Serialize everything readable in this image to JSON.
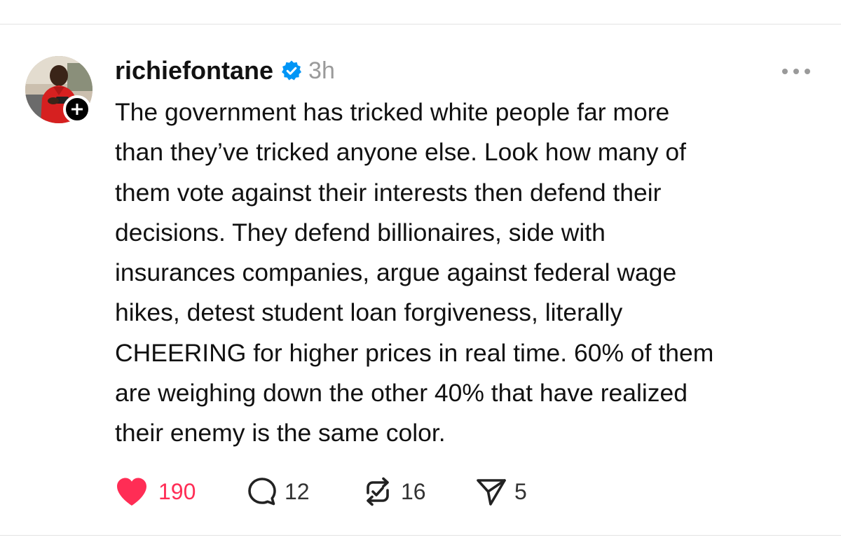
{
  "post": {
    "username": "richiefontane",
    "verified": true,
    "timestamp": "3h",
    "body_lines": [
      "The government has tricked white people far more",
      "than they’ve tricked anyone else. Look how many of",
      "them vote against their interests then defend their",
      "decisions. They defend billionaires, side with",
      "insurances companies, argue against federal wage",
      "hikes, detest student loan forgiveness, literally",
      "CHEERING for higher prices in real time. 60% of them",
      "are weighing down the other 40% that have realized",
      "their enemy is the same color."
    ]
  },
  "actions": {
    "likes": "190",
    "replies": "12",
    "reposts": "16",
    "shares": "5"
  },
  "icons": {
    "like": "heart-filled-icon",
    "reply": "speech-bubble-icon",
    "repost": "repost-icon",
    "share": "paper-plane-icon",
    "more": "more-dots-icon",
    "verified": "verified-badge-icon",
    "follow": "plus-icon"
  },
  "colors": {
    "like": "#ff2d55",
    "verified": "#0095f6",
    "timestamp": "#9a9a9a",
    "text": "#111111"
  }
}
